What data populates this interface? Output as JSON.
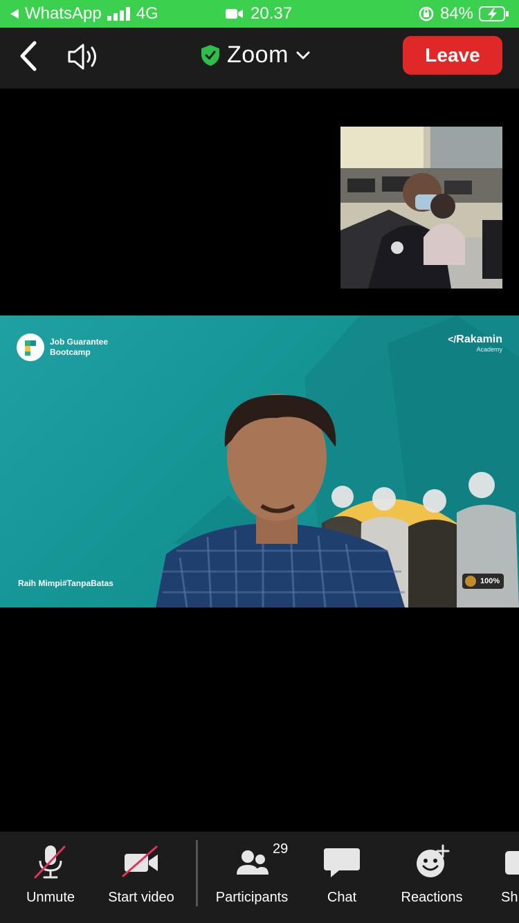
{
  "status_bar": {
    "back_app": "WhatsApp",
    "network": "4G",
    "time": "20.37",
    "battery": "84%"
  },
  "toolbar": {
    "title": "Zoom",
    "leave_label": "Leave"
  },
  "slide": {
    "left_logo": "Job Guarantee\nBootcamp",
    "right_logo_name": "Rakamin",
    "right_logo_sub": "Academy",
    "tagline": "Raih Mimpi#TanpaBatas",
    "badge": "100%"
  },
  "bottom_bar": {
    "unmute_label": "Unmute",
    "start_video_label": "Start video",
    "participants_label": "Participants",
    "participants_count": "29",
    "chat_label": "Chat",
    "reactions_label": "Reactions",
    "share_label": "Sh"
  },
  "colors": {
    "status_bar": "#3bd14f",
    "leave": "#e02828",
    "toolbar_bg": "#1c1c1c",
    "shield": "#2dbd4a",
    "mute_slash": "#e0335a"
  }
}
